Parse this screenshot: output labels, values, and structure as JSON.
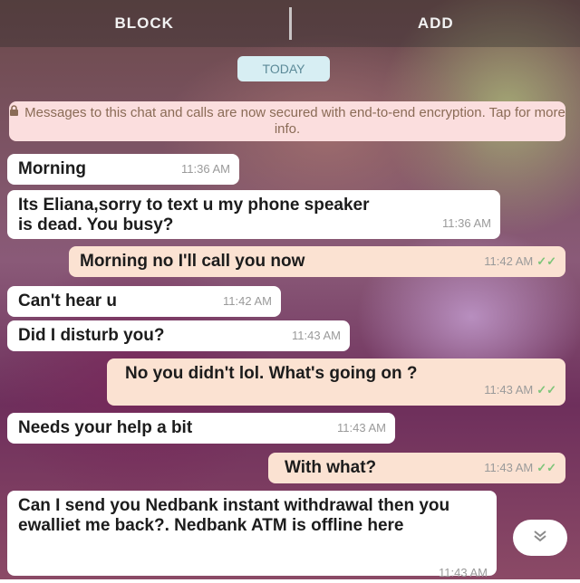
{
  "appbar": {
    "block_label": "BLOCK",
    "add_label": "ADD"
  },
  "date_chip": "TODAY",
  "encryption_notice": "Messages to this chat and calls are now secured with end-to-end encryption. Tap for more info.",
  "messages": [
    {
      "direction": "in",
      "text": "Morning",
      "time": "11:36 AM"
    },
    {
      "direction": "in",
      "text": "Its Eliana,sorry to text u my phone speaker is dead. You busy?",
      "time": "11:36 AM"
    },
    {
      "direction": "out",
      "text": "Morning no I'll call you now",
      "time": "11:42 AM",
      "status": "read"
    },
    {
      "direction": "in",
      "text": "Can't hear u",
      "time": "11:42 AM"
    },
    {
      "direction": "in",
      "text": "Did I disturb you?",
      "time": "11:43 AM"
    },
    {
      "direction": "out",
      "text": "No you didn't lol. What's going on ?",
      "time": "11:43 AM",
      "status": "read"
    },
    {
      "direction": "in",
      "text": "Needs your help a bit",
      "time": "11:43 AM"
    },
    {
      "direction": "out",
      "text": "With what?",
      "time": "11:43 AM",
      "status": "read"
    },
    {
      "direction": "in",
      "text": "Can I send you Nedbank instant withdrawal then you ewalliet me back?. Nedbank ATM is offline here",
      "time": "11:43 AM"
    }
  ],
  "ticks_glyph": "✓✓",
  "colors": {
    "incoming": "#ffffff",
    "outgoing": "#fbe2d2",
    "read_tick": "#7fc57a"
  },
  "icons": {
    "lock": "lock-icon",
    "scroll_down": "chevron-double-down-icon"
  }
}
